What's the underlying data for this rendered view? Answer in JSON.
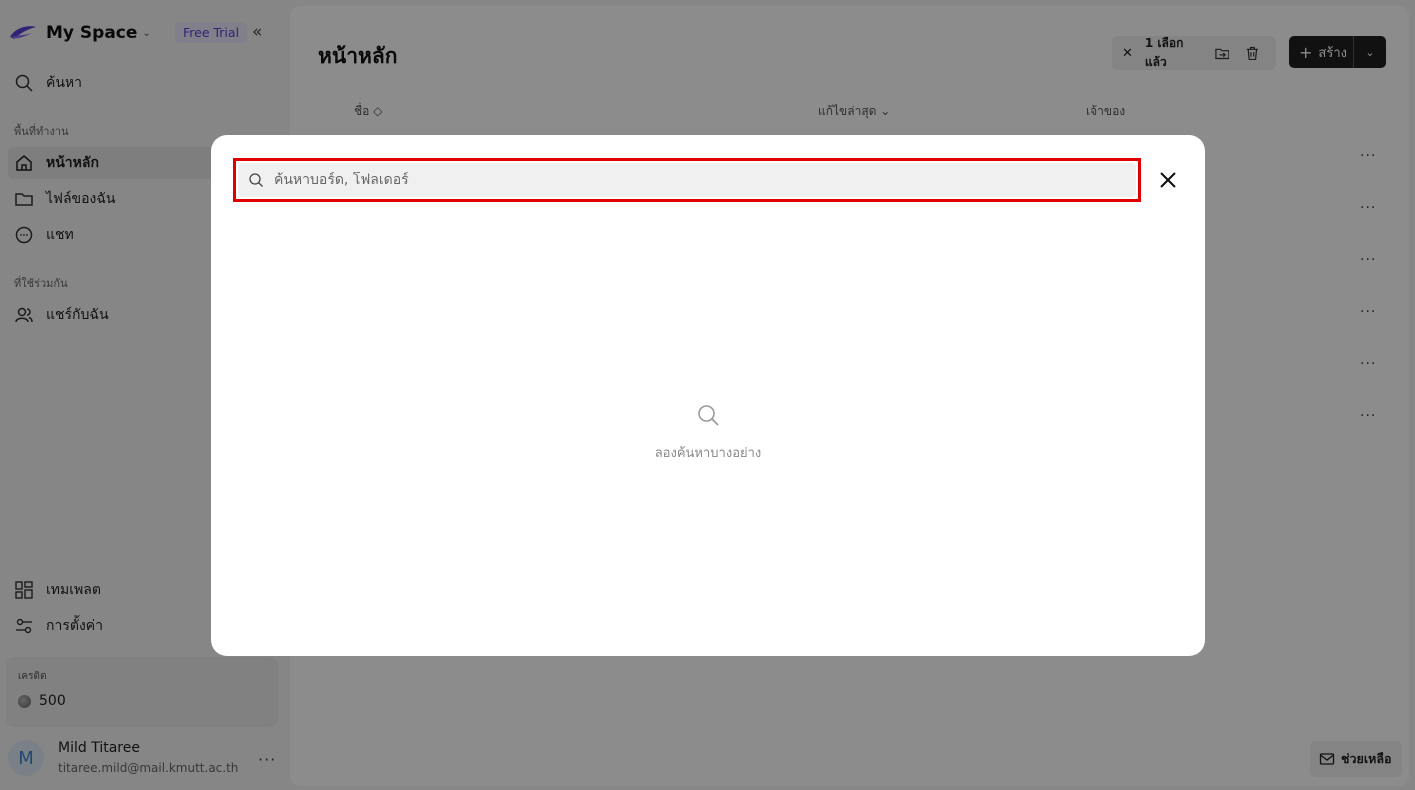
{
  "sidebar": {
    "brand": "My Space",
    "trial_badge": "Free Trial",
    "search_label": "ค้นหา",
    "workspace_section": "พื้นที่ทำงาน",
    "nav": [
      {
        "label": "หน้าหลัก"
      },
      {
        "label": "ไฟล์ของฉัน"
      },
      {
        "label": "แชท"
      }
    ],
    "shared_section": "ที่ใช้ร่วมกัน",
    "shared_label": "แชร์กับฉัน",
    "templates_label": "เทมเพลต",
    "settings_label": "การตั้งค่า",
    "credit_label": "เครดิต",
    "credit_value": "500",
    "user": {
      "initial": "M",
      "name": "Mild Titaree",
      "email": "titaree.mild@mail.kmutt.ac.th"
    }
  },
  "main": {
    "title": "หน้าหลัก",
    "selection_count": "1 เลือกแล้ว",
    "create_label": "สร้าง",
    "columns": {
      "name": "ชื่อ",
      "modified": "แก้ไขล่าสุด",
      "owner": "เจ้าของ"
    },
    "row_more": "..."
  },
  "help_label": "ช่วยเหลือ",
  "modal": {
    "search_placeholder": "ค้นหาบอร์ด, โฟลเดอร์",
    "empty_text": "ลองค้นหาบางอย่าง"
  }
}
